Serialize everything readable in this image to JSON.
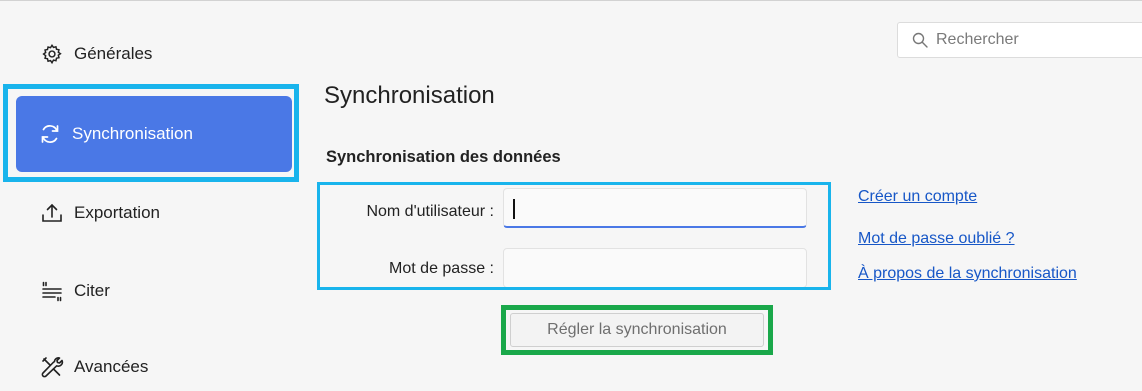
{
  "sidebar": {
    "items": [
      {
        "label": "Générales",
        "icon": "gear-icon"
      },
      {
        "label": "Synchronisation",
        "icon": "sync-icon",
        "active": true
      },
      {
        "label": "Exportation",
        "icon": "export-icon"
      },
      {
        "label": "Citer",
        "icon": "cite-icon"
      },
      {
        "label": "Avancées",
        "icon": "tools-icon"
      }
    ]
  },
  "search": {
    "placeholder": "Rechercher",
    "icon": "search-icon"
  },
  "main": {
    "title": "Synchronisation",
    "section_title": "Synchronisation des données",
    "username_label": "Nom d'utilisateur :",
    "username_value": "",
    "password_label": "Mot de passe :",
    "password_value": "",
    "links": [
      "Créer un compte",
      "Mot de passe oublié ?",
      "À propos de la synchronisation"
    ],
    "sync_button": "Régler la synchronisation"
  },
  "colors": {
    "accent": "#4a78e6",
    "highlight_blue": "#19b4ec",
    "highlight_green": "#1aa84a",
    "link": "#1757c7"
  }
}
